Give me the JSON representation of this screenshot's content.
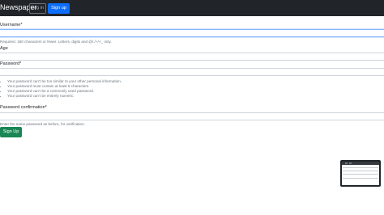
{
  "navbar": {
    "brand": "Newspaper",
    "login_label": "Log in",
    "signup_label": "Sign up"
  },
  "form": {
    "username": {
      "label": "Username*",
      "value": "",
      "help": "Required. 150 characters or fewer. Letters, digits and @/./+/-/_ only."
    },
    "age": {
      "label": "Age",
      "value": ""
    },
    "password": {
      "label": "Password*",
      "value": "",
      "rules": [
        "Your password can’t be too similar to your other personal information.",
        "Your password must contain at least 8 characters.",
        "Your password can’t be a commonly used password.",
        "Your password can’t be entirely numeric."
      ]
    },
    "password_confirmation": {
      "label": "Password confirmation*",
      "value": "",
      "help": "Enter the same password as before, for verification."
    },
    "submit_label": "Sign Up"
  },
  "colors": {
    "navbar_bg": "#212529",
    "signup_button": "#0d6efd",
    "submit_button": "#198754"
  }
}
